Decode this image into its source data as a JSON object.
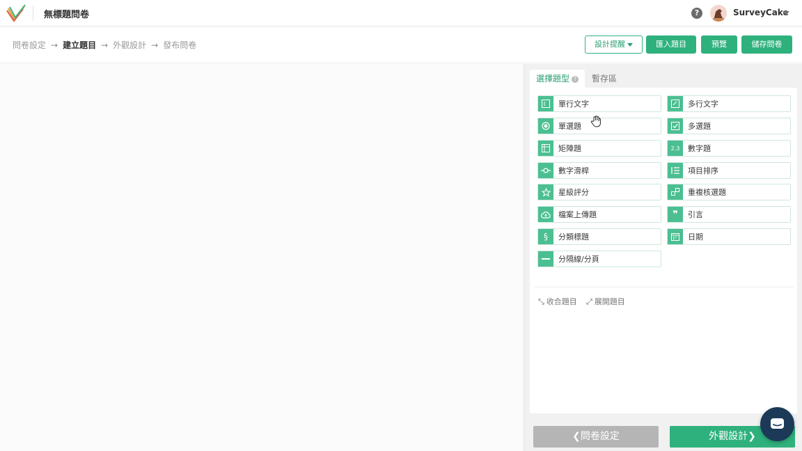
{
  "header": {
    "doc_title": "無標題問卷",
    "username": "SurveyCake",
    "help_glyph": "?"
  },
  "breadcrumb": {
    "steps": [
      "問卷設定",
      "建立題目",
      "外觀設計",
      "發布問卷"
    ],
    "arrow": "→",
    "active_index": 1
  },
  "toolbar": {
    "design_hint_label": "設計提醒",
    "import_label": "匯入題目",
    "preview_label": "預覽",
    "save_label": "儲存問卷"
  },
  "panel": {
    "tabs": [
      {
        "label": "選擇題型",
        "help": "?"
      },
      {
        "label": "暫存區"
      }
    ],
    "question_types": [
      {
        "label": "單行文字",
        "icon": "single-line-text-icon",
        "glyph": "I"
      },
      {
        "label": "多行文字",
        "icon": "multi-line-text-icon",
        "glyph": "≡"
      },
      {
        "label": "單選題",
        "icon": "radio-icon",
        "glyph": "◉"
      },
      {
        "label": "多選題",
        "icon": "checkbox-icon",
        "glyph": "☑"
      },
      {
        "label": "矩陣題",
        "icon": "matrix-icon",
        "glyph": "▦"
      },
      {
        "label": "數字題",
        "icon": "number-icon",
        "glyph": "2.3"
      },
      {
        "label": "數字滑桿",
        "icon": "slider-icon",
        "glyph": "-o-"
      },
      {
        "label": "項目排序",
        "icon": "ranking-icon",
        "glyph": "☰"
      },
      {
        "label": "星級評分",
        "icon": "star-icon",
        "glyph": "☆"
      },
      {
        "label": "重複核選題",
        "icon": "repeat-check-icon",
        "glyph": "▢"
      },
      {
        "label": "檔案上傳題",
        "icon": "upload-icon",
        "glyph": "☁"
      },
      {
        "label": "引言",
        "icon": "quote-icon",
        "glyph": "❞"
      },
      {
        "label": "分類標題",
        "icon": "section-icon",
        "glyph": "§"
      },
      {
        "label": "日期",
        "icon": "calendar-icon",
        "glyph": "▦"
      },
      {
        "label": "分隔線/分頁",
        "icon": "divider-icon",
        "glyph": "—"
      }
    ],
    "collapse_label": "收合題目",
    "expand_label": "展開題目"
  },
  "footer": {
    "back_label": "問卷設定",
    "next_label": "外觀設計"
  },
  "colors": {
    "brand_green": "#2eb17d",
    "icon_green": "#4cbf92",
    "disabled_gray": "#b5b5b5",
    "chat_navy": "#1c3a57"
  }
}
